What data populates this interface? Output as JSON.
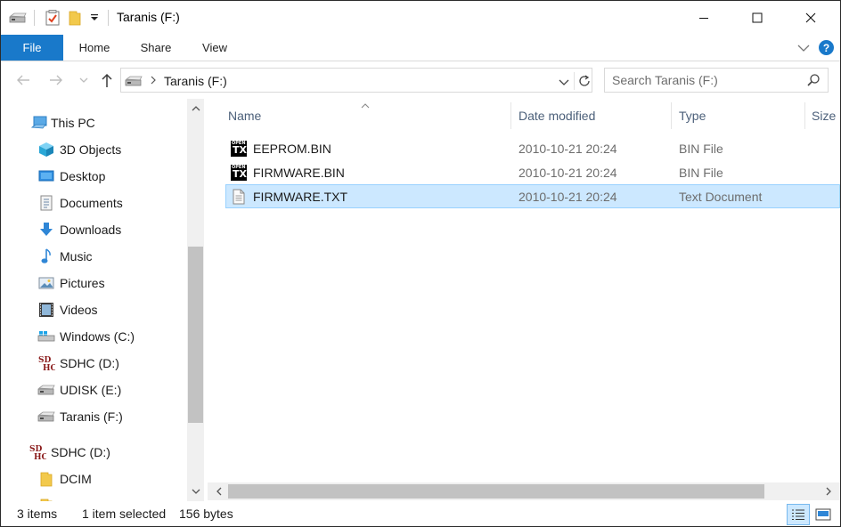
{
  "window": {
    "title": "Taranis (F:)"
  },
  "ribbon": {
    "tabs": [
      "File",
      "Home",
      "Share",
      "View"
    ],
    "help_label": "?"
  },
  "address_bar": {
    "path_label": "Taranis (F:)"
  },
  "search": {
    "placeholder": "Search Taranis (F:)"
  },
  "nav_pane": {
    "items": [
      {
        "label": "This PC",
        "icon": "this-pc-icon"
      },
      {
        "label": "3D Objects",
        "icon": "3d-objects-icon"
      },
      {
        "label": "Desktop",
        "icon": "desktop-icon"
      },
      {
        "label": "Documents",
        "icon": "documents-icon"
      },
      {
        "label": "Downloads",
        "icon": "downloads-icon"
      },
      {
        "label": "Music",
        "icon": "music-icon"
      },
      {
        "label": "Pictures",
        "icon": "pictures-icon"
      },
      {
        "label": "Videos",
        "icon": "videos-icon"
      },
      {
        "label": "Windows (C:)",
        "icon": "windows-drive-icon"
      },
      {
        "label": "SDHC (D:)",
        "icon": "sdhc-icon"
      },
      {
        "label": "UDISK (E:)",
        "icon": "usb-drive-icon"
      },
      {
        "label": "Taranis (F:)",
        "icon": "usb-drive-icon"
      },
      {
        "label": "SDHC (D:)",
        "icon": "sdhc-icon"
      },
      {
        "label": "DCIM",
        "icon": "folder-icon"
      }
    ]
  },
  "file_list": {
    "columns": [
      "Name",
      "Date modified",
      "Type",
      "Size"
    ],
    "files": [
      {
        "name": "EEPROM.BIN",
        "date": "2010-10-21 20:24",
        "type": "BIN File",
        "icon": "opentx-icon",
        "selected": false
      },
      {
        "name": "FIRMWARE.BIN",
        "date": "2010-10-21 20:24",
        "type": "BIN File",
        "icon": "opentx-icon",
        "selected": false
      },
      {
        "name": "FIRMWARE.TXT",
        "date": "2010-10-21 20:24",
        "type": "Text Document",
        "icon": "text-document-icon",
        "selected": true
      }
    ],
    "opentx_icon_text": {
      "top": "OPEN",
      "bottom": "TX"
    }
  },
  "sdhc_icon_text": {
    "top": "SD",
    "bottom": "HC"
  },
  "status_bar": {
    "item_count": "3 items",
    "selection": "1 item selected",
    "size": "156 bytes"
  },
  "colors": {
    "accent": "#1979ca",
    "selection_bg": "#cce8ff",
    "selection_border": "#99d1ff",
    "header_text": "#4c607a"
  }
}
